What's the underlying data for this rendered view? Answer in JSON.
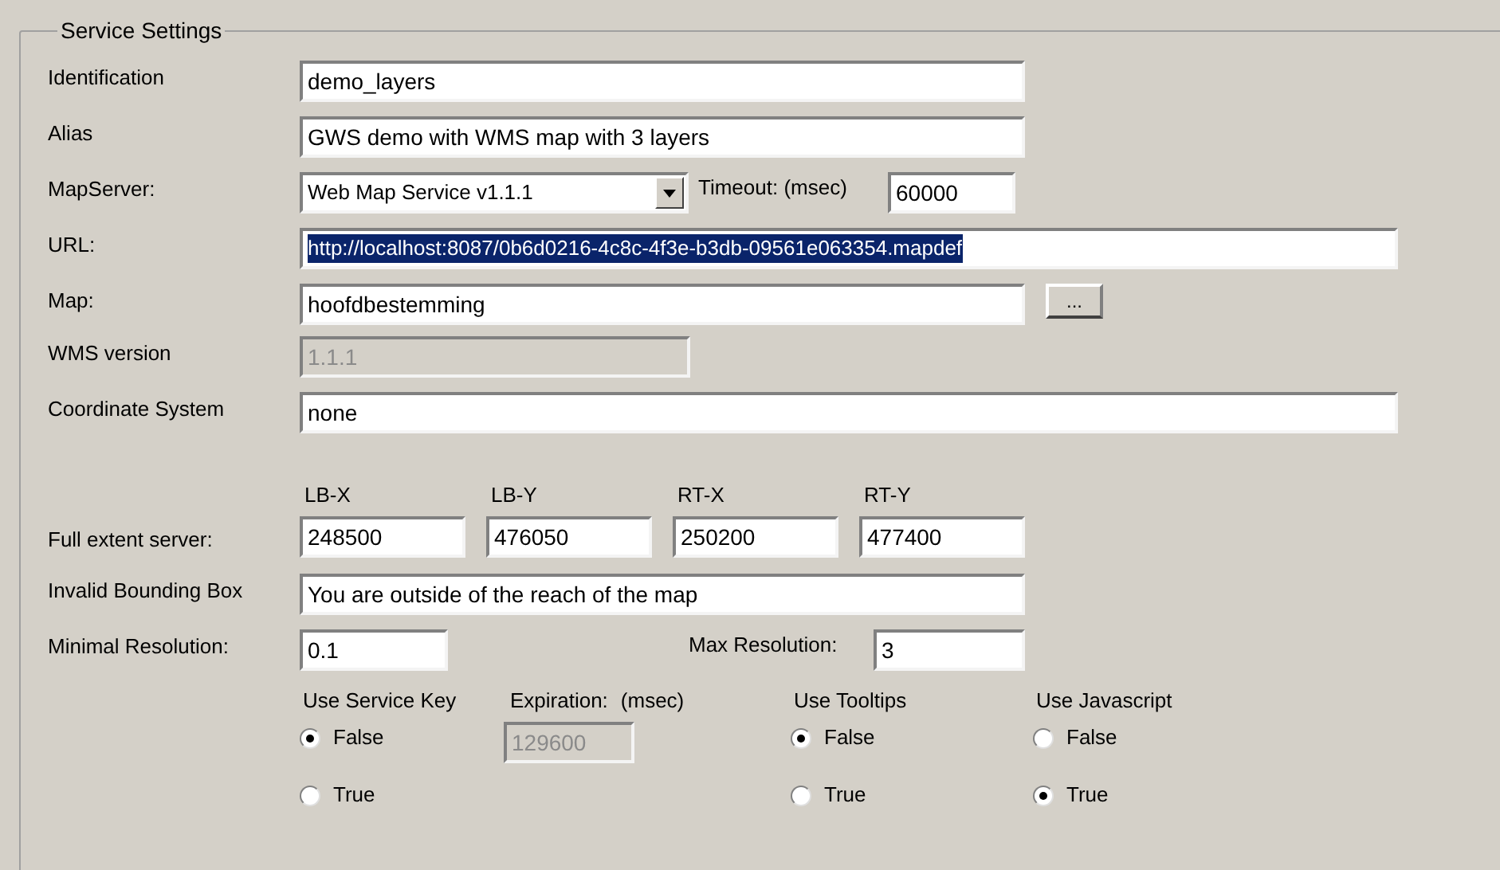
{
  "group_title": "Service Settings",
  "identification": {
    "label": "Identification",
    "value": "demo_layers"
  },
  "alias": {
    "label": "Alias",
    "value": "GWS demo with WMS map with 3 layers"
  },
  "map_server": {
    "label": "MapServer:",
    "value": "Web Map Service v1.1.1",
    "timeout_label": "Timeout: (msec)",
    "timeout_value": "60000"
  },
  "url": {
    "label": "URL:",
    "value": "http://localhost:8087/0b6d0216-4c8c-4f3e-b3db-09561e063354.mapdef",
    "selected": true
  },
  "map": {
    "label": "Map:",
    "value": "hoofdbestemming",
    "browse_button": "..."
  },
  "wms_version": {
    "label": "WMS version",
    "value": "1.1.1",
    "disabled": true
  },
  "coordinate_system": {
    "label": "Coordinate System",
    "value": "none"
  },
  "full_extent": {
    "label": "Full extent server:",
    "columns": [
      {
        "label": "LB-X",
        "value": "248500"
      },
      {
        "label": "LB-Y",
        "value": "476050"
      },
      {
        "label": "RT-X",
        "value": "250200"
      },
      {
        "label": "RT-Y",
        "value": "477400"
      }
    ]
  },
  "invalid_bbox": {
    "label": "Invalid Bounding Box",
    "value": "You are outside of the reach of the map"
  },
  "min_resolution": {
    "label": "Minimal Resolution:",
    "value": "0.1"
  },
  "max_resolution": {
    "label": "Max Resolution:",
    "value": "3"
  },
  "service_key": {
    "title": "Use Service Key",
    "radios": [
      {
        "label": "False",
        "selected": true
      },
      {
        "label": "True",
        "selected": false
      }
    ]
  },
  "expiration": {
    "label": "Expiration:",
    "unit": "(msec)",
    "value": "129600",
    "disabled": true
  },
  "tooltips": {
    "title": "Use Tooltips",
    "radios": [
      {
        "label": "False",
        "selected": true
      },
      {
        "label": "True",
        "selected": false
      }
    ]
  },
  "javascript": {
    "title": "Use Javascript",
    "radios": [
      {
        "label": "False",
        "selected": false
      },
      {
        "label": "True",
        "selected": true
      }
    ]
  }
}
